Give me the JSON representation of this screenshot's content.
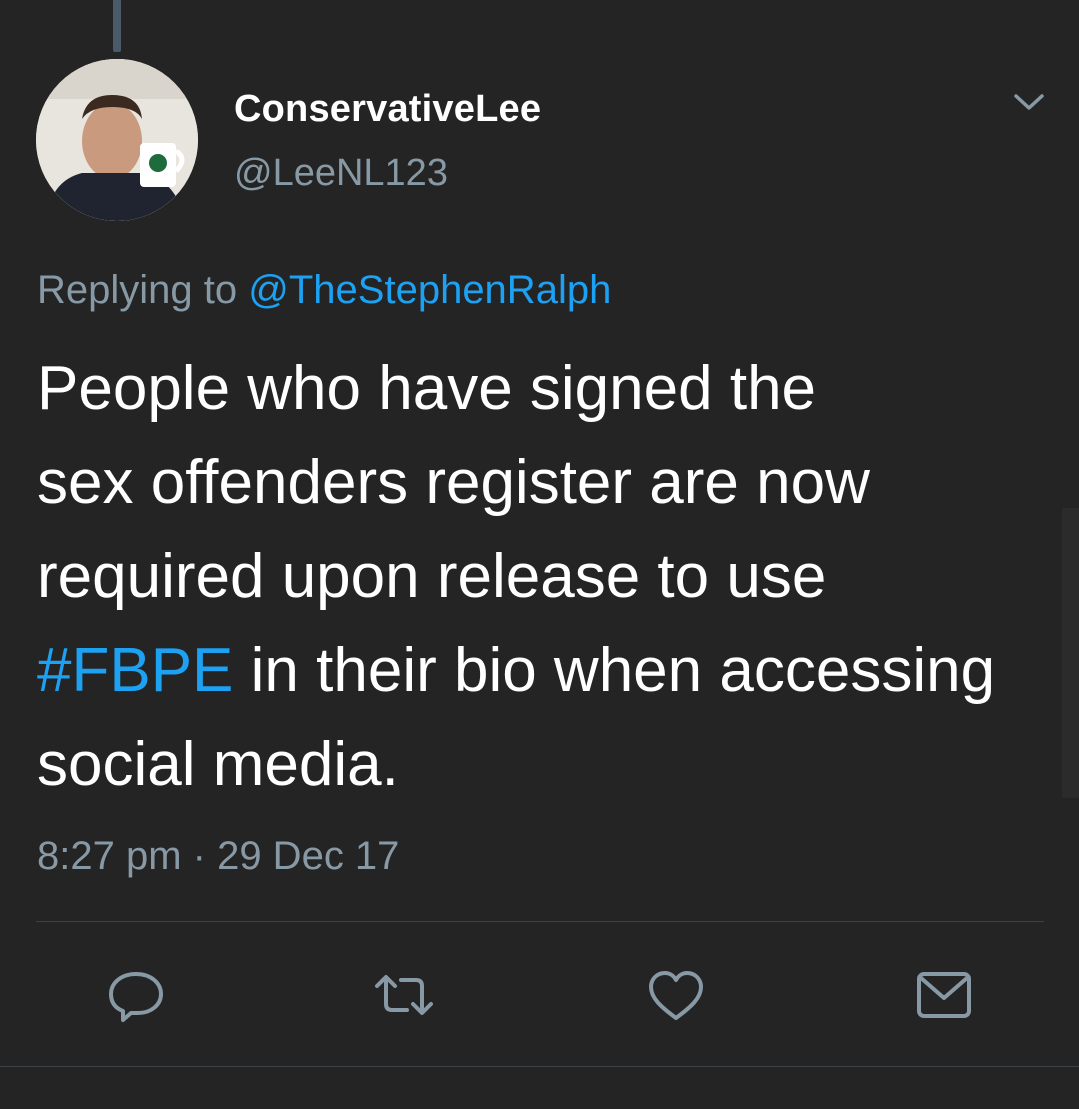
{
  "tweet": {
    "display_name": "ConservativeLee",
    "handle": "@LeeNL123",
    "replying_prefix": "Replying to",
    "replying_to": "@TheStephenRalph",
    "text_lines": [
      "People who have signed the",
      "sex offenders register are now",
      "required upon release to use"
    ],
    "hashtag": "#FBPE",
    "text_after_hashtag": " in their bio when accessing",
    "text_last_line": "social media.",
    "timestamp": "8:27 pm · 29 Dec 17"
  },
  "actions": {
    "icons": [
      "reply-icon",
      "retweet-icon",
      "like-icon",
      "direct-message-icon"
    ]
  },
  "colors": {
    "background": "#242424",
    "text": "#ffffff",
    "muted": "#8899a6",
    "link": "#1da1f2"
  }
}
